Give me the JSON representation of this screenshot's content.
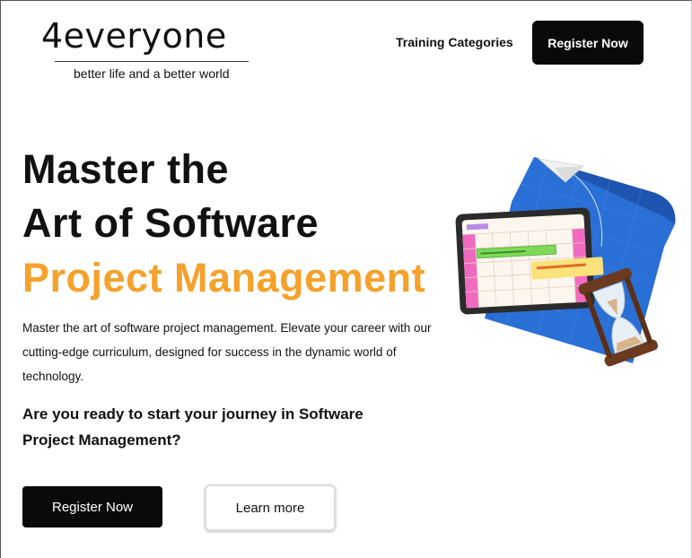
{
  "brand": {
    "name": "4everyone",
    "tagline": "better life and a better world"
  },
  "nav": {
    "training_link": "Training Categories",
    "register_button": "Register Now"
  },
  "hero": {
    "title_line1": "Master the",
    "title_line2": "Art of Software",
    "title_line3": "Project Management",
    "accent_color": "#f5a12b",
    "description": "Master the art of software project management. Elevate your career with our cutting-edge curriculum, designed for success in the dynamic world of technology.",
    "question": "Are you ready to start your journey in Software Project Management?",
    "primary_button": "Register Now",
    "secondary_button": "Learn more"
  },
  "illustration": {
    "icon": "calendar-hourglass-illustration"
  }
}
